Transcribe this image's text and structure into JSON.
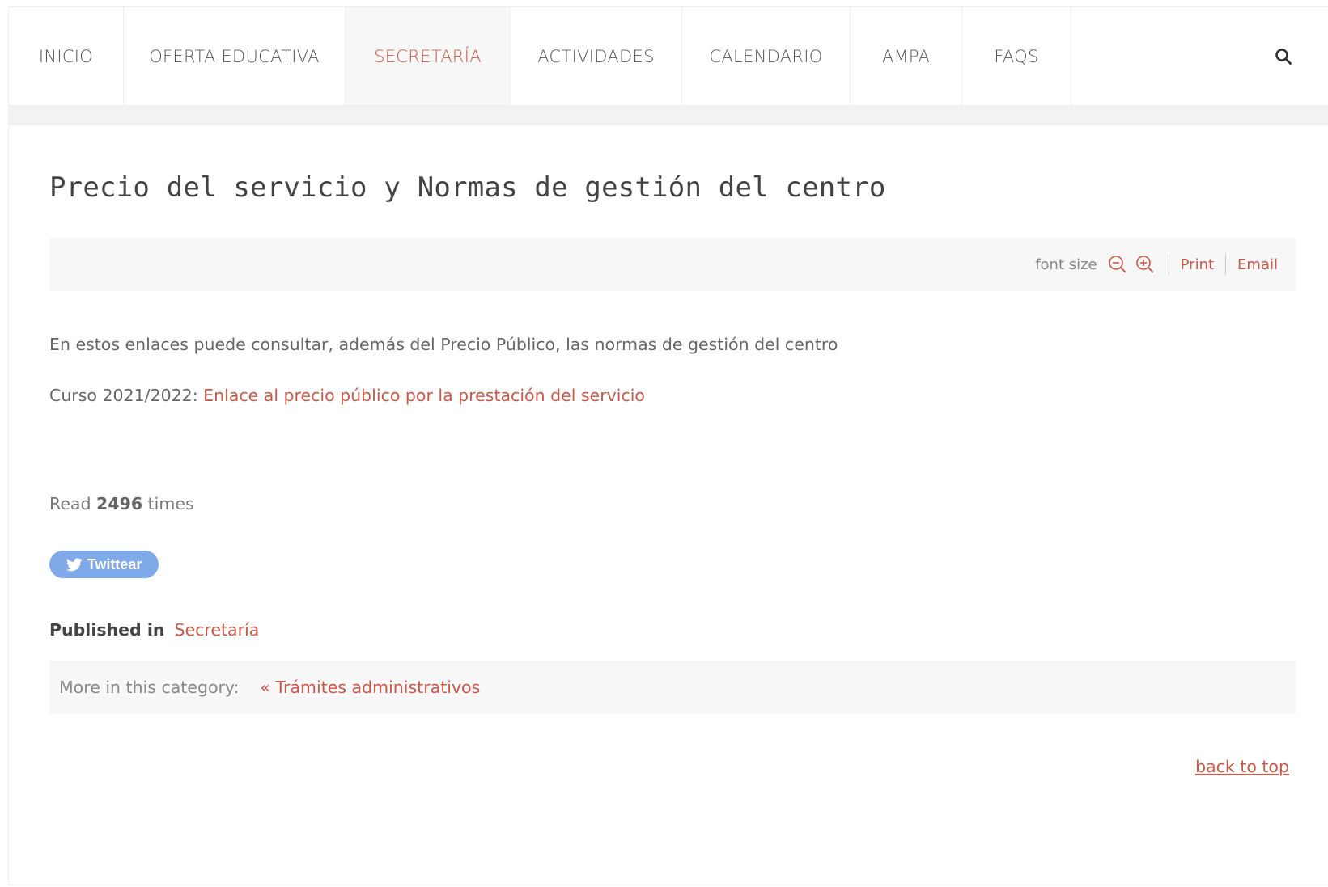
{
  "nav": {
    "items": [
      {
        "label": "INICIO"
      },
      {
        "label": "OFERTA EDUCATIVA"
      },
      {
        "label": "SECRETARÍA"
      },
      {
        "label": "ACTIVIDADES"
      },
      {
        "label": "CALENDARIO"
      },
      {
        "label": "AMPA"
      },
      {
        "label": "FAQS"
      }
    ],
    "active": "SECRETARÍA",
    "search_icon": "search-icon"
  },
  "article": {
    "title": "Precio del servicio y Normas de gestión del centro",
    "tools": {
      "font_size_label": "font size",
      "decrease_icon": "zoom-out-icon",
      "increase_icon": "zoom-in-icon",
      "print_label": "Print",
      "email_label": "Email"
    },
    "intro": "En estos enlaces puede consultar, además del Precio Público, las normas de gestión del centro",
    "course_label": "Curso 2021/2022: ",
    "course_link": "Enlace al precio público por la prestación del servicio",
    "read_prefix": "Read",
    "read_count": "2496",
    "read_suffix": "times",
    "tweet_label": "Twittear",
    "published_label": "Published in",
    "published_category": "Secretaría",
    "more_label": "More in this category:",
    "more_link": "« Trámites administrativos",
    "back_to_top": "back to top"
  },
  "colors": {
    "accent": "#c8584a",
    "tweet": "#7fa9e8",
    "bar_bg": "#f7f7f7"
  }
}
